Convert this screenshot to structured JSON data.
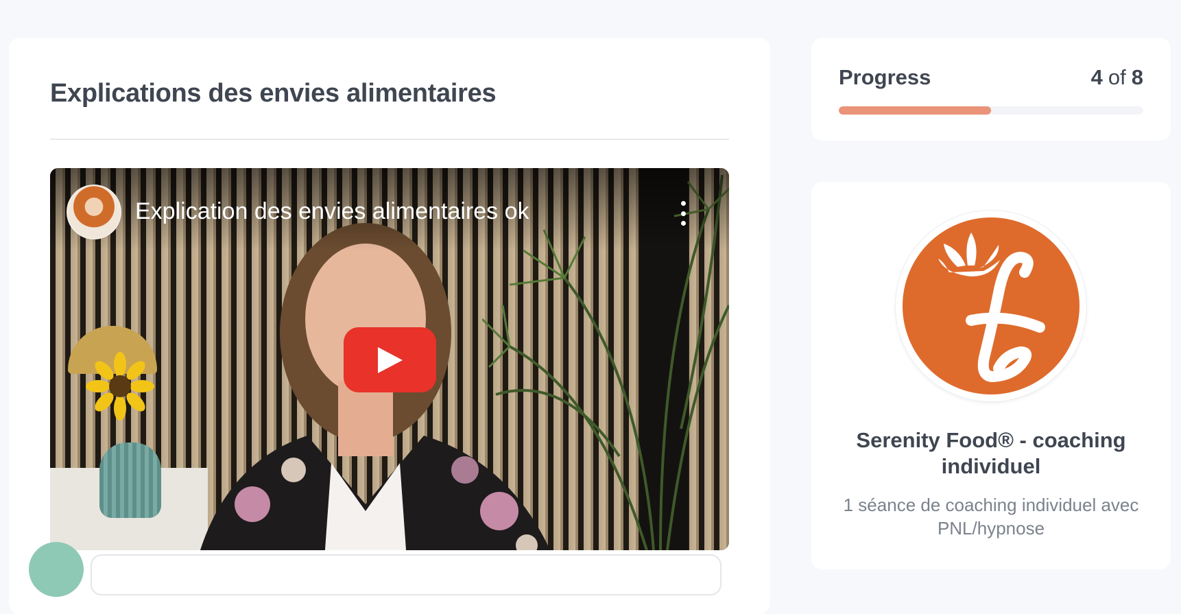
{
  "lesson": {
    "title": "Explications des envies alimentaires"
  },
  "video": {
    "title": "Explication des envies alimentaires ok",
    "play_icon": "play-icon",
    "menu_icon": "vertical-dots-icon",
    "brand_color": "#e8322a"
  },
  "progress": {
    "label": "Progress",
    "current": "4",
    "separator": "of",
    "total": "8",
    "fraction": 0.5,
    "fill_color": "#ea9378"
  },
  "course": {
    "title": "Serenity Food® - coaching individuel",
    "description": "1 séance de coaching individuel avec PNL/hypnose",
    "logo_color": "#de6b2c"
  }
}
